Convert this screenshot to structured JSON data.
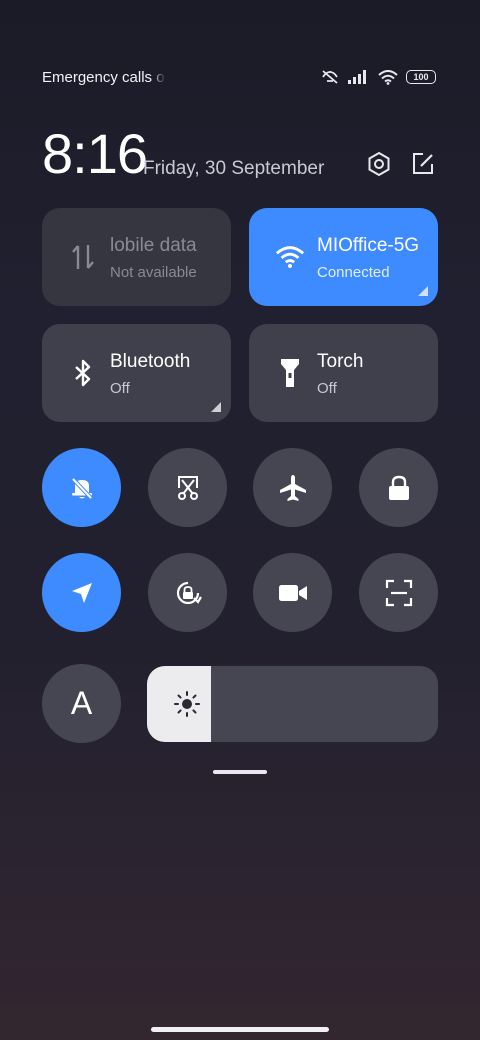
{
  "status_bar": {
    "carrier_text": "Emergency calls o",
    "battery_level": "100",
    "icons": [
      "muted-alert-icon",
      "signal-icon",
      "wifi-icon",
      "battery-icon"
    ]
  },
  "header": {
    "time": "8:16",
    "date": "Friday, 30 September",
    "actions": [
      "settings-icon",
      "edit-icon"
    ]
  },
  "tiles": [
    {
      "id": "mobile-data",
      "name": "lobile data",
      "state": "Not available",
      "icon": "mobile-data-icon",
      "status": "disabled",
      "has_expand": false
    },
    {
      "id": "wifi",
      "name": "MIOffice-5G",
      "state": "Connected",
      "icon": "wifi-icon",
      "status": "active",
      "has_expand": true
    },
    {
      "id": "bluetooth",
      "name": "Bluetooth",
      "state": "Off",
      "icon": "bluetooth-icon",
      "status": "off",
      "has_expand": true
    },
    {
      "id": "torch",
      "name": "Torch",
      "state": "Off",
      "icon": "torch-icon",
      "status": "off",
      "has_expand": false
    }
  ],
  "toggles_row1": [
    {
      "id": "silent",
      "icon": "bell-off-icon",
      "active": true
    },
    {
      "id": "screenshot",
      "icon": "scissors-icon",
      "active": false
    },
    {
      "id": "airplane",
      "icon": "airplane-icon",
      "active": false
    },
    {
      "id": "lock",
      "icon": "lock-icon",
      "active": false
    }
  ],
  "toggles_row2": [
    {
      "id": "location",
      "icon": "location-icon",
      "active": true
    },
    {
      "id": "auto-rotate",
      "icon": "rotation-lock-icon",
      "active": false
    },
    {
      "id": "screen-record",
      "icon": "video-camera-icon",
      "active": false
    },
    {
      "id": "scanner",
      "icon": "scan-icon",
      "active": false
    }
  ],
  "font_toggle": {
    "label": "A",
    "icon": "font-size-icon"
  },
  "brightness": {
    "level_percent": 22,
    "icon": "sun-icon"
  },
  "colors": {
    "accent": "#3e8bff",
    "tile": "#40404d",
    "round": "#464653"
  }
}
